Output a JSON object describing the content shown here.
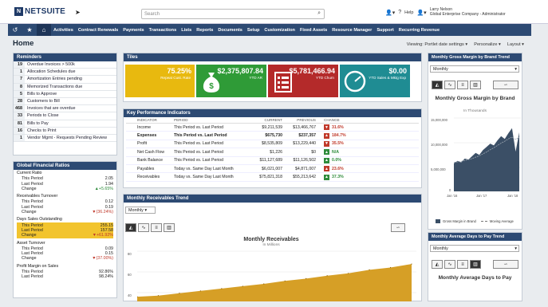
{
  "header": {
    "logo_text": "NETSUITE",
    "search_placeholder": "Search",
    "help_label": "Help",
    "user_name": "Larry Nelson",
    "user_role": "Global Enterprise Company - Administrator"
  },
  "nav": {
    "items": [
      "Activities",
      "Contract Renewals",
      "Payments",
      "Transactions",
      "Lists",
      "Reports",
      "Documents",
      "Setup",
      "Customization",
      "Fixed Assets",
      "Resource Manager",
      "Support",
      "Recurring Revenue"
    ]
  },
  "page": {
    "title": "Home",
    "viewing": "Viewing: Portlet date settings",
    "personalize": "Personalize",
    "layout": "Layout"
  },
  "reminders": {
    "title": "Reminders",
    "items": [
      {
        "count": "19",
        "label": "Overdue Invoices > 500k"
      },
      {
        "count": "1",
        "label": "Allocation Schedules due"
      },
      {
        "count": "7",
        "label": "Amortization Entries pending"
      },
      {
        "count": "8",
        "label": "Memorized Transactions due"
      },
      {
        "count": "5",
        "label": "Bills to Approve"
      },
      {
        "count": "28",
        "label": "Customers to Bill"
      },
      {
        "count": "468",
        "label": "Invoices that are overdue"
      },
      {
        "count": "33",
        "label": "Periods to Close"
      },
      {
        "count": "81",
        "label": "Bills to Pay"
      },
      {
        "count": "16",
        "label": "Checks to Print"
      },
      {
        "count": "1",
        "label": "Vendor Mgmt - Requests Pending Review"
      }
    ]
  },
  "financial_ratios": {
    "title": "Global Financial Ratios",
    "groups": [
      {
        "name": "Current Ratio",
        "lines": [
          {
            "label": "This Period",
            "value": "2.05"
          },
          {
            "label": "Last Period",
            "value": "1.94"
          },
          {
            "label": "Change",
            "value": "+5.65%",
            "dir": "pos"
          }
        ]
      },
      {
        "name": "Receivables Turnover",
        "lines": [
          {
            "label": "This Period",
            "value": "0.12"
          },
          {
            "label": "Last Period",
            "value": "0.19"
          },
          {
            "label": "Change",
            "value": "(36.24%)",
            "dir": "neg"
          }
        ]
      },
      {
        "name": "Days Sales Outstanding",
        "lines": [
          {
            "label": "This Period",
            "value": "255.15",
            "hl": true
          },
          {
            "label": "Last Period",
            "value": "157.58",
            "hl": true
          },
          {
            "label": "Change",
            "value": "+61.92%",
            "dir": "neg",
            "hl": true
          }
        ]
      },
      {
        "name": "Asset Turnover",
        "lines": [
          {
            "label": "This Period",
            "value": "0.09"
          },
          {
            "label": "Last Period",
            "value": "0.15"
          },
          {
            "label": "Change",
            "value": "(37.00%)",
            "dir": "neg"
          }
        ]
      },
      {
        "name": "Profit Margin on Sales",
        "lines": [
          {
            "label": "This Period",
            "value": "92.86%"
          },
          {
            "label": "Last Period",
            "value": "98.24%"
          }
        ]
      }
    ]
  },
  "tiles": {
    "title": "Tiles",
    "items": [
      {
        "value": "75.25%",
        "label": "Repeat Cust. Rate",
        "color": "#e8b90f"
      },
      {
        "value": "$2,375,807.84",
        "label": "YTD AR",
        "color": "#2f9b37"
      },
      {
        "value": "$5,781,466.94",
        "label": "YTD Churn",
        "color": "#b42a2a"
      },
      {
        "value": "$0.00",
        "label": "YTD Sales & Mktg Exp",
        "color": "#1f8c93"
      }
    ]
  },
  "kpi": {
    "title": "Key Performance Indicators",
    "headers": [
      "INDICATOR",
      "PERIOD",
      "CURRENT",
      "PREVIOUS",
      "CHANGE"
    ],
    "rows": [
      {
        "indicator": "Income",
        "period": "This Period vs. Last Period",
        "current": "$9,211,539",
        "previous": "$13,466,767",
        "change": "31.6%",
        "arrow": "▼",
        "dir": "neg"
      },
      {
        "indicator": "Expenses",
        "period": "This Period vs. Last Period",
        "current": "$675,730",
        "previous": "$237,357",
        "change": "184.7%",
        "arrow": "▲",
        "dir": "neg",
        "bold": true
      },
      {
        "indicator": "Profit",
        "period": "This Period vs. Last Period",
        "current": "$8,535,809",
        "previous": "$13,229,440",
        "change": "35.5%",
        "arrow": "▼",
        "dir": "neg"
      },
      {
        "indicator": "Net Cash Flow",
        "period": "This Period vs. Last Period",
        "current": "$1,226",
        "previous": "$0",
        "change": "N/A",
        "arrow": "▲",
        "dir": "pos"
      },
      {
        "indicator": "Bank Balance",
        "period": "This Period vs. Last Period",
        "current": "$11,127,689",
        "previous": "$11,126,502",
        "change": "0.0%",
        "arrow": "▲",
        "dir": "pos"
      },
      {
        "indicator": "Payables",
        "period": "Today vs. Same Day Last Month",
        "current": "$6,021,007",
        "previous": "$4,871,007",
        "change": "23.6%",
        "arrow": "▲",
        "dir": "neg"
      },
      {
        "indicator": "Receivables",
        "period": "Today vs. Same Day Last Month",
        "current": "$75,821,318",
        "previous": "$55,213,642",
        "change": "37.3%",
        "arrow": "▲",
        "dir": "pos"
      }
    ]
  },
  "receivables_trend": {
    "title": "Monthly Receivables Trend",
    "period": "Monthly",
    "chart_title": "Monthly Receivables",
    "chart_subtitle": "In Millions",
    "y_ticks": [
      "80",
      "60",
      "40"
    ]
  },
  "gross_margin": {
    "title": "Monthly Gross Margin by Brand Trend",
    "period": "Monthly",
    "chart_title": "Monthly Gross Margin by Brand",
    "chart_subtitle": "In Thousands",
    "y_ticks": [
      "15,000,000",
      "10,000,000",
      "5,000,000",
      "0"
    ],
    "x_ticks": [
      "Jan '16",
      "Jan '17",
      "Jan '18"
    ],
    "legend": [
      "Gross Margin in Brand",
      "Moving Average"
    ]
  },
  "days_to_pay": {
    "title": "Monthly Average Days to Pay Trend",
    "period": "Monthly",
    "chart_title": "Monthly Average Days to Pay"
  },
  "colors": {
    "nav": "#2d4a73",
    "accent": "#e8b90f",
    "area": "#d49a1a"
  },
  "chart_data": [
    {
      "type": "area",
      "title": "Monthly Receivables",
      "subtitle": "In Millions",
      "x": [
        1,
        2,
        3,
        4,
        5,
        6,
        7,
        8,
        9,
        10,
        11,
        12,
        13,
        14
      ],
      "values": [
        8,
        10,
        14,
        18,
        22,
        26,
        30,
        35,
        39,
        44,
        48,
        54,
        58,
        64
      ],
      "ylim": [
        0,
        90
      ]
    },
    {
      "type": "area",
      "title": "Monthly Gross Margin by Brand",
      "subtitle": "In Thousands",
      "x_ticks": [
        "Jan '16",
        "Jan '17",
        "Jan '18"
      ],
      "series": [
        {
          "name": "Gross Margin in Brand",
          "values": [
            6.0,
            6.5,
            6.2,
            7.0,
            6.8,
            7.5,
            8.2,
            7.8,
            8.8,
            9.5,
            10.2,
            9.8,
            10.9,
            11.8,
            11.2,
            12.4,
            13.5,
            8.5,
            12.6
          ]
        },
        {
          "name": "Moving Average",
          "values": [
            6.2,
            6.3,
            6.4,
            6.6,
            6.8,
            7.0,
            7.3,
            7.6,
            8.0,
            8.4,
            8.9,
            9.3,
            9.8,
            10.3,
            10.7,
            11.2,
            11.6,
            11.1,
            11.5
          ]
        }
      ],
      "ylim": [
        0,
        16
      ]
    }
  ]
}
